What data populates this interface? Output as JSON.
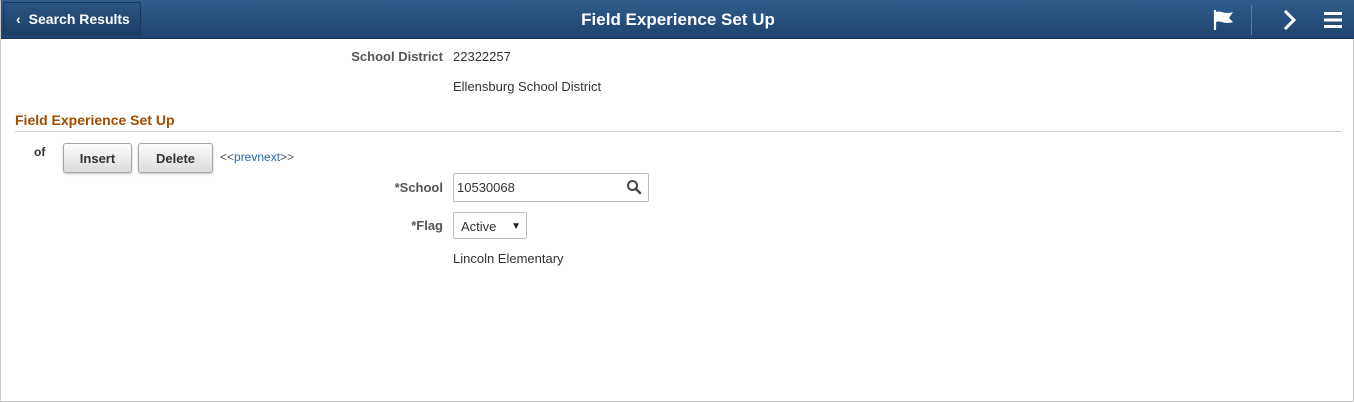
{
  "header": {
    "back_label": "Search Results",
    "title": "Field Experience Set Up"
  },
  "district": {
    "label": "School District",
    "code": "22322257",
    "name": "Ellensburg School District"
  },
  "section": {
    "title": "Field Experience Set Up",
    "of_label": "of",
    "insert_label": "Insert",
    "delete_label": "Delete",
    "nav_open": "<<",
    "prev_label": "prev",
    "next_label": "next",
    "nav_close": ">>"
  },
  "form": {
    "school_label": "*School",
    "school_value": "10530068",
    "flag_label": "*Flag",
    "flag_value": "Active",
    "school_name": "Lincoln Elementary"
  },
  "icons": {
    "back": "chevron-left-icon",
    "flag": "flag-icon",
    "next": "chevron-right-icon",
    "menu": "hamburger-menu-icon",
    "search": "search-icon"
  }
}
